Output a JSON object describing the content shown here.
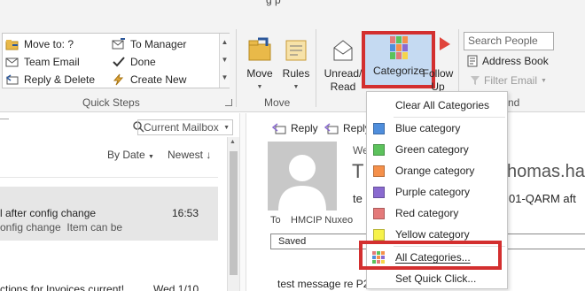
{
  "title_fragment": "g  p",
  "quick_steps": {
    "group_label": "Quick Steps",
    "items": [
      {
        "label": "Move to: ?",
        "icon": "folder-arrow-icon"
      },
      {
        "label": "To Manager",
        "icon": "envelope-arrow-icon"
      },
      {
        "label": "Team Email",
        "icon": "team-email-icon"
      },
      {
        "label": "Done",
        "icon": "checkmark-icon"
      },
      {
        "label": "Reply & Delete",
        "icon": "reply-delete-icon"
      },
      {
        "label": "Create New",
        "icon": "lightning-icon"
      }
    ]
  },
  "move_group": {
    "label": "Move",
    "move_button": "Move",
    "rules_button": "Rules"
  },
  "tags_group": {
    "unread_read_line1": "Unread/",
    "unread_read_line2": "Read",
    "categorize": "Categorize",
    "follow_up_line1": "Follow",
    "follow_up_line2": "Up"
  },
  "find_group": {
    "search_people_placeholder": "Search People",
    "address_book": "Address Book",
    "filter_email": "Filter Email",
    "label_fragment": "nd"
  },
  "list_pane": {
    "search_scope": "Current Mailbox",
    "sort_by": "By Date",
    "sort_order": "Newest",
    "messages": [
      {
        "subject": "l after config change",
        "preview": "onfig change  Item can be",
        "time": "16:53",
        "selected": true
      },
      {
        "subject": "ctions for Invoices current!",
        "preview": "",
        "time": "Wed 1/10",
        "selected": false
      }
    ]
  },
  "reading_pane": {
    "reply": "Reply",
    "reply_all_fragment": "Reply",
    "date_fragment": "We",
    "sender_fragment": "T",
    "sender_email_fragment": "homas.ha",
    "subject_fragment": "te",
    "subject_tail": "01-QARM aft",
    "to_label": "To",
    "to_value": "HMCIP Nuxeo",
    "saved_label": "Saved",
    "body_fragment": "test message re P2"
  },
  "categorize_menu": {
    "clear_all": "Clear All Categories",
    "categories": [
      {
        "label": "Blue category",
        "color": "#4f8edc"
      },
      {
        "label": "Green category",
        "color": "#5cc25c"
      },
      {
        "label": "Orange category",
        "color": "#f5904a"
      },
      {
        "label": "Purple category",
        "color": "#8a6ad0"
      },
      {
        "label": "Red category",
        "color": "#e47a7a"
      },
      {
        "label": "Yellow category",
        "color": "#f6f24a"
      }
    ],
    "all_categories": "All Categories...",
    "set_quick_click": "Set Quick Click..."
  },
  "colors": {
    "highlight_red": "#d32f2f",
    "accent_blue": "#2b579a"
  }
}
